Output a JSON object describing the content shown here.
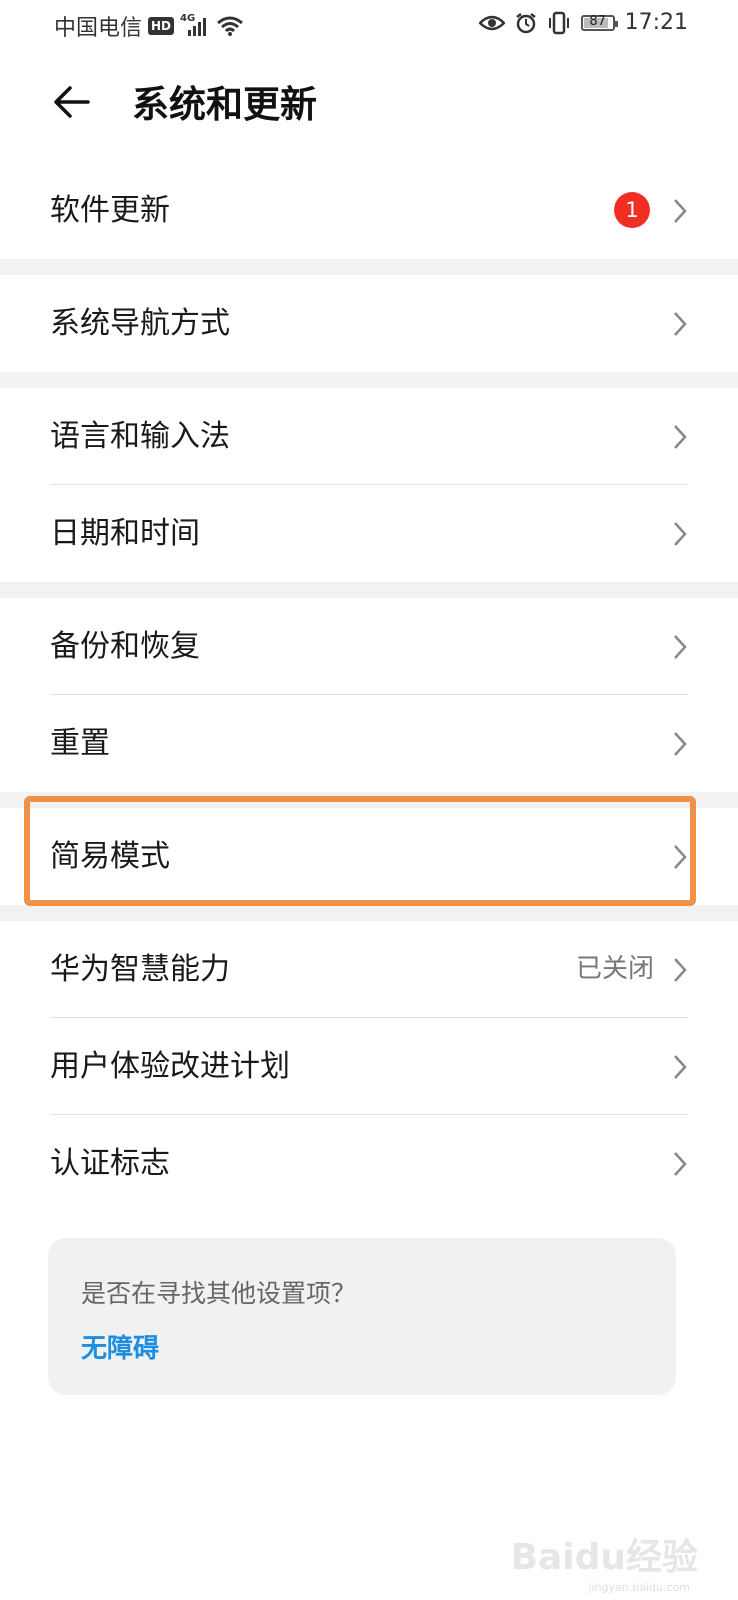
{
  "status_bar": {
    "carrier": "中国电信",
    "hd": "HD",
    "network": "4G",
    "battery": "87",
    "time": "17:21",
    "icons": [
      "eye-comfort-icon",
      "alarm-icon",
      "vibrate-icon",
      "battery-icon"
    ]
  },
  "header": {
    "title": "系统和更新",
    "back_icon": "back-arrow-icon"
  },
  "groups": [
    {
      "items": [
        {
          "label": "软件更新",
          "badge": "1"
        }
      ]
    },
    {
      "items": [
        {
          "label": "系统导航方式"
        }
      ]
    },
    {
      "items": [
        {
          "label": "语言和输入法"
        },
        {
          "label": "日期和时间"
        }
      ]
    },
    {
      "items": [
        {
          "label": "备份和恢复"
        },
        {
          "label": "重置"
        }
      ]
    },
    {
      "items": [
        {
          "label": "简易模式"
        }
      ]
    },
    {
      "items": [
        {
          "label": "华为智慧能力",
          "value": "已关闭"
        },
        {
          "label": "用户体验改进计划"
        },
        {
          "label": "认证标志"
        }
      ]
    }
  ],
  "suggestion": {
    "question": "是否在寻找其他设置项？",
    "link": "无障碍"
  },
  "watermark": {
    "main": "Baidu经验",
    "sub": "jingyan.baidu.com"
  },
  "colors": {
    "badge": "#f02f24",
    "highlight": "#f0914a",
    "link": "#1e8fe0",
    "separator": "#f2f2f2"
  }
}
